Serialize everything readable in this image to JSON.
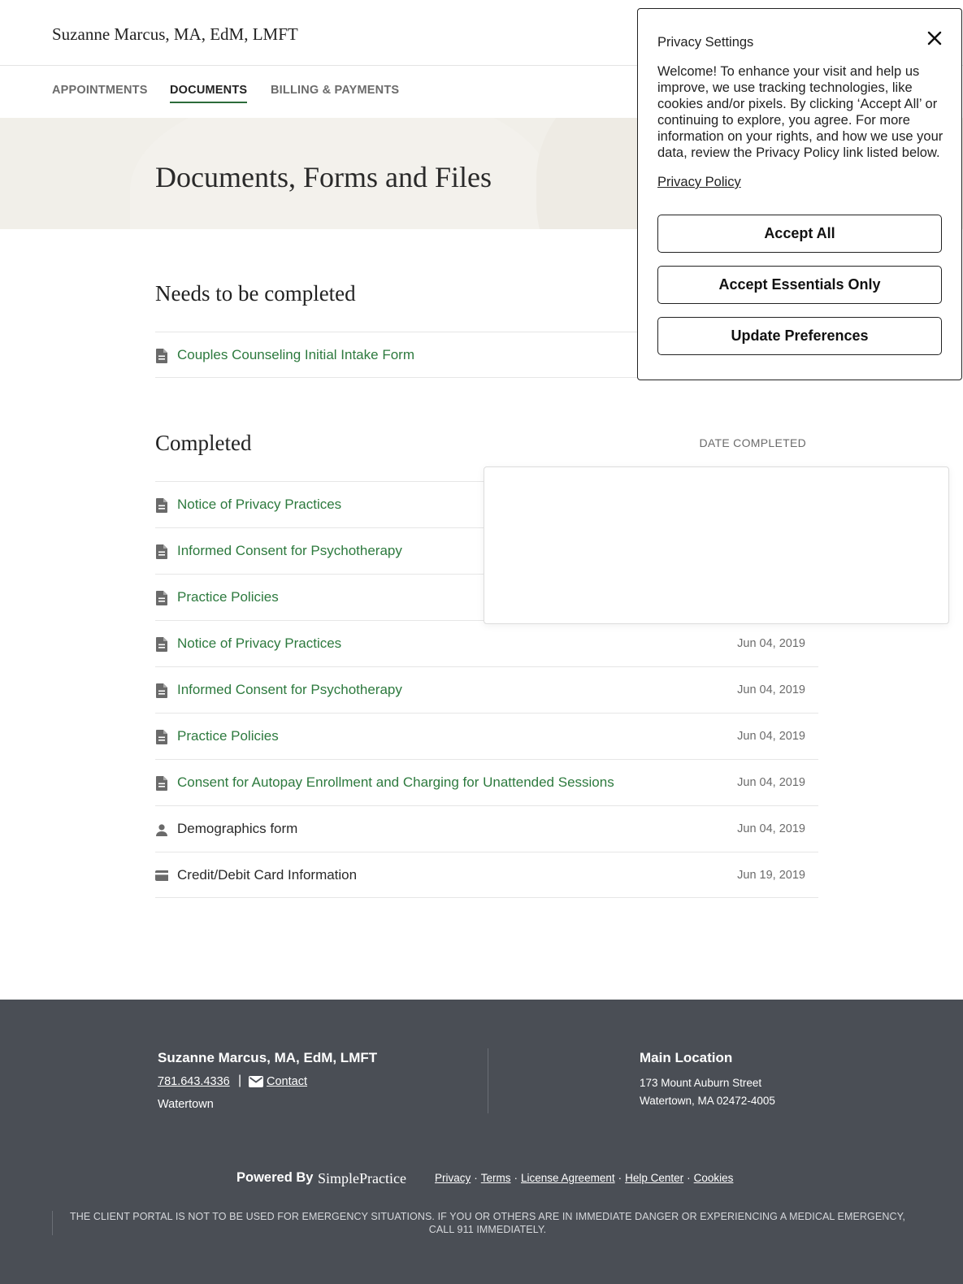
{
  "header": {
    "brand": "Suzanne Marcus, MA, EdM, LMFT"
  },
  "nav": {
    "tabs": [
      {
        "label": "APPOINTMENTS"
      },
      {
        "label": "DOCUMENTS"
      },
      {
        "label": "BILLING & PAYMENTS"
      }
    ],
    "active": "DOCUMENTS"
  },
  "hero": {
    "title": "Documents, Forms and Files"
  },
  "needs": {
    "title": "Needs to be completed",
    "items": [
      {
        "name": "Couples Counseling Initial Intake Form",
        "icon": "document-icon"
      }
    ]
  },
  "completed": {
    "title": "Completed",
    "date_header": "DATE COMPLETED",
    "items": [
      {
        "name": "Notice of Privacy Practices",
        "date": "",
        "icon": "document-icon"
      },
      {
        "name": "Informed Consent for Psychotherapy",
        "date": "",
        "icon": "document-icon"
      },
      {
        "name": "Practice Policies",
        "date": "",
        "icon": "document-icon"
      },
      {
        "name": "Notice of Privacy Practices",
        "date": "Jun 04, 2019",
        "icon": "document-icon"
      },
      {
        "name": "Informed Consent for Psychotherapy",
        "date": "Jun 04, 2019",
        "icon": "document-icon"
      },
      {
        "name": "Practice Policies",
        "date": "Jun 04, 2019",
        "icon": "document-icon"
      },
      {
        "name": "Consent for Autopay Enrollment and Charging for Unattended Sessions",
        "date": "Jun 04, 2019",
        "icon": "document-icon"
      },
      {
        "name": "Demographics form",
        "date": "Jun 04, 2019",
        "icon": "person-icon"
      },
      {
        "name": "Credit/Debit Card Information",
        "date": "Jun 19, 2019",
        "icon": "credit-card-icon"
      }
    ]
  },
  "footer": {
    "name": "Suzanne Marcus, MA, EdM, LMFT",
    "phone": "781.643.4336",
    "separator": "|",
    "contact": "Contact",
    "city": "Watertown",
    "location_title": "Main Location",
    "address_line1": "173 Mount Auburn Street",
    "address_line2": "Watertown, MA 02472-4005",
    "powered_by": "Powered By",
    "logo": "SimplePractice",
    "links": [
      "Privacy",
      "Terms",
      "License Agreement",
      "Help Center",
      "Cookies"
    ],
    "link_separator": "·",
    "disclaimer": "THE CLIENT PORTAL IS NOT TO BE USED FOR EMERGENCY SITUATIONS. IF YOU OR OTHERS ARE IN IMMEDIATE DANGER OR EXPERIENCING A MEDICAL EMERGENCY, CALL 911 IMMEDIATELY."
  },
  "privacy_modal": {
    "title": "Privacy Settings",
    "body": "Welcome! To enhance your visit and help us improve, we use tracking technologies, like cookies and/or pixels. By clicking ‘Accept All’ or continuing to explore, you agree. For more information on your rights, and how we use your data, review the Privacy Policy link listed below.",
    "policy_link": "Privacy Policy",
    "buttons": {
      "accept_all": "Accept All",
      "accept_essentials": "Accept Essentials Only",
      "update_prefs": "Update Preferences"
    }
  },
  "colors": {
    "link_green": "#2d7a3e",
    "footer_bg": "#4a4e55",
    "hero_bg": "#f1efe9"
  }
}
